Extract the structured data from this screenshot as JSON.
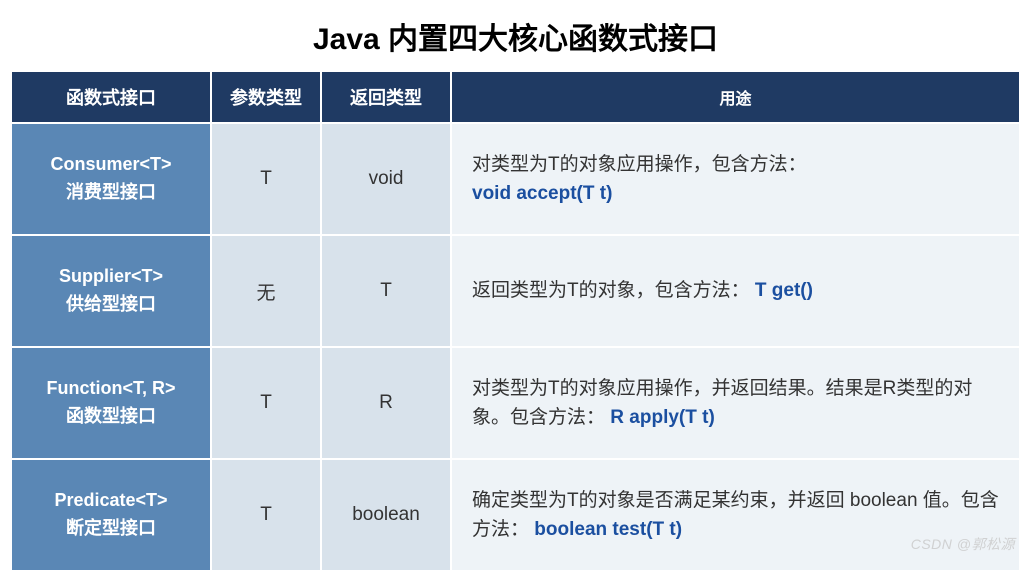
{
  "title": "Java 内置四大核心函数式接口",
  "headers": {
    "col1": "函数式接口",
    "col2": "参数类型",
    "col3": "返回类型",
    "col4": "用途"
  },
  "rows": [
    {
      "iface_name": "Consumer<T>",
      "iface_cn": "消费型接口",
      "param": "T",
      "ret": "void",
      "usage_text": "对类型为T的对象应用操作，包含方法：",
      "method": "void accept(T t)"
    },
    {
      "iface_name": "Supplier<T>",
      "iface_cn": "供给型接口",
      "param": "无",
      "ret": "T",
      "usage_text": "返回类型为T的对象，包含方法：",
      "method": "T get()"
    },
    {
      "iface_name": "Function<T, R>",
      "iface_cn": "函数型接口",
      "param": "T",
      "ret": "R",
      "usage_text": "对类型为T的对象应用操作，并返回结果。结果是R类型的对象。包含方法：",
      "method": "R apply(T t)"
    },
    {
      "iface_name": "Predicate<T>",
      "iface_cn": "断定型接口",
      "param": "T",
      "ret": "boolean",
      "usage_text": "确定类型为T的对象是否满足某约束，并返回 boolean 值。包含方法：",
      "method": "boolean test(T t)"
    }
  ],
  "watermark": "CSDN @郭松源"
}
